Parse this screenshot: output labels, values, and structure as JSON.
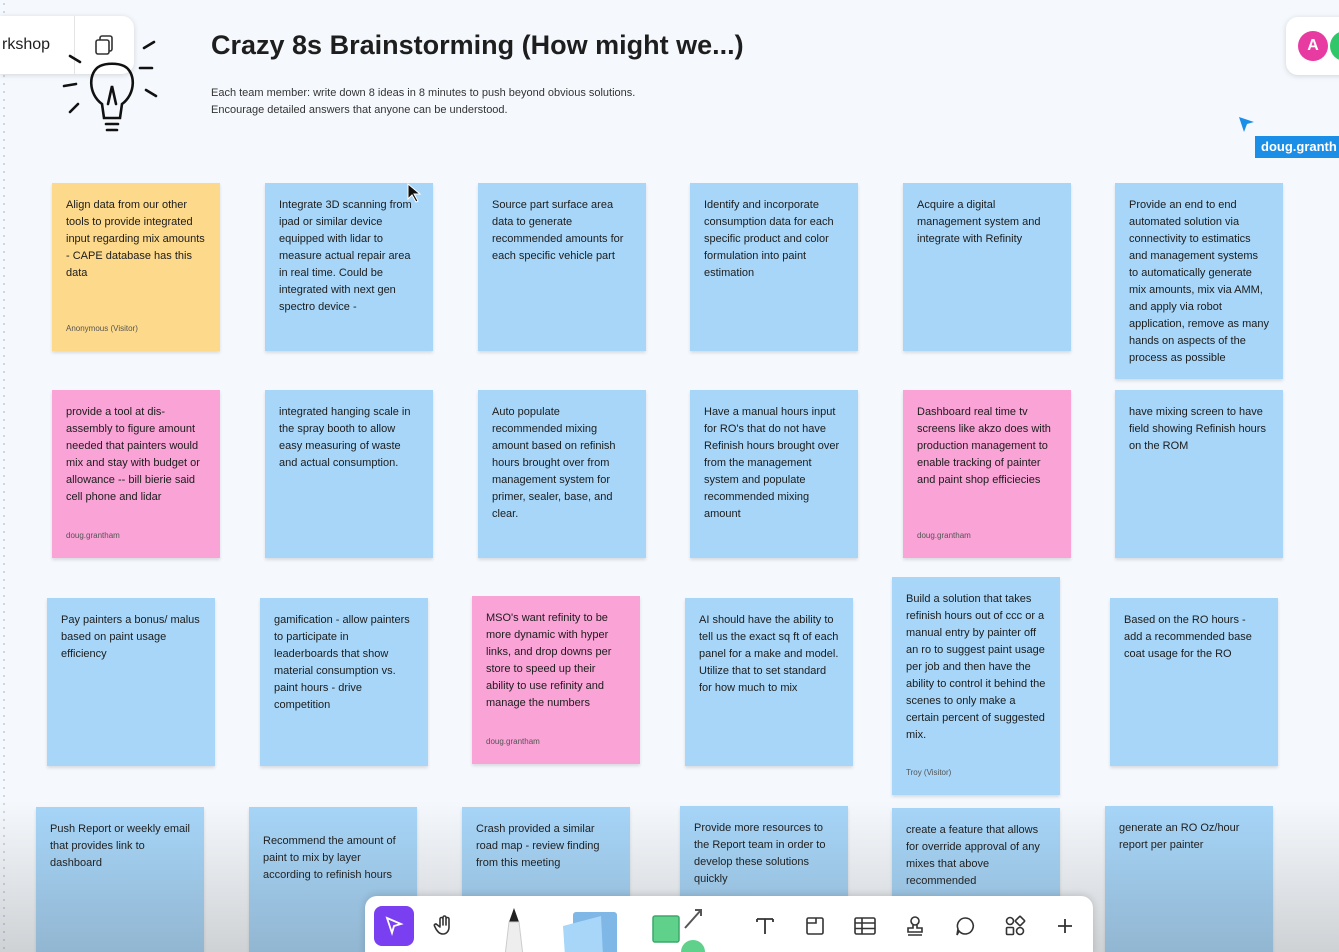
{
  "file": {
    "name": "rkshop"
  },
  "header": {
    "title": "Crazy 8s Brainstorming (How might we...)",
    "subtitle_line1": "Each team member: write down 8 ideas in 8 minutes to push beyond obvious solutions.",
    "subtitle_line2": "Encourage detailed answers that anyone can be understood."
  },
  "collaborators": {
    "avatar_a": "A",
    "cursor_label": "doug.granth"
  },
  "colors": {
    "blue": "#a7d6f9",
    "yellow": "#fdd98b",
    "pink": "#f9a3d6",
    "accent": "#7b3ff2",
    "cursor": "#1b8ee8"
  },
  "notes": [
    {
      "color": "yellow",
      "text": "Align data from our other tools to provide integrated input regarding mix amounts - CAPE database has this data",
      "author": "Anonymous (Visitor)"
    },
    {
      "color": "blue",
      "text": "Integrate 3D scanning from ipad or similar device equipped with lidar to measure actual repair area in real time.  Could be integrated with next gen spectro device -",
      "author": ""
    },
    {
      "color": "blue",
      "text": "Source part surface area data to generate recommended amounts for each specific vehicle part",
      "author": ""
    },
    {
      "color": "blue",
      "text": "Identify and incorporate consumption data for each specific product and color formulation into paint estimation",
      "author": ""
    },
    {
      "color": "blue",
      "text": "Acquire a digital management system and integrate with Refinity",
      "author": ""
    },
    {
      "color": "blue",
      "text": "Provide an end to end automated solution via connectivity to estimatics and management systems to automatically generate mix amounts, mix via AMM, and apply via robot application, remove as many hands on aspects of the process as possible",
      "author": ""
    },
    {
      "color": "pink",
      "text": "provide a tool at dis-assembly to figure amount needed that painters would mix and stay with budget or allowance -- bill bierie said cell phone and lidar",
      "author": "doug.grantham"
    },
    {
      "color": "blue",
      "text": "integrated hanging scale in the spray booth to allow easy measuring of waste and actual consumption.",
      "author": ""
    },
    {
      "color": "blue",
      "text": "Auto populate recommended mixing amount based on refinish hours brought over from management system for primer, sealer, base, and clear.",
      "author": ""
    },
    {
      "color": "blue",
      "text": "Have a manual hours input for RO's that do not have Refinish hours brought over from the management system and populate recommended mixing amount",
      "author": ""
    },
    {
      "color": "pink",
      "text": "Dashboard real time tv screens like akzo does with production management to enable tracking of painter and paint shop efficiecies",
      "author": "doug.grantham"
    },
    {
      "color": "blue",
      "text": "have mixing screen to have field showing Refinish hours on the ROM",
      "author": ""
    },
    {
      "color": "blue",
      "text": "Pay painters a bonus/ malus based on paint usage efficiency",
      "author": ""
    },
    {
      "color": "blue",
      "text": "gamification - allow painters to participate in leaderboards that show material consumption vs. paint hours - drive competition",
      "author": ""
    },
    {
      "color": "pink",
      "text": "MSO's want refinity to be more dynamic with hyper links, and drop downs per store to speed up their ability to use refinity and manage the numbers",
      "author": "doug.grantham"
    },
    {
      "color": "blue",
      "text": "AI should have the ability to tell us the exact sq ft of each panel for a make and model. Utilize that to set standard for how much to mix",
      "author": ""
    },
    {
      "color": "blue",
      "text": "Build a solution that takes refinish hours out of ccc or a manual entry by painter off an ro to suggest paint usage per job and then have the ability to control it behind the scenes to only make a certain percent of suggested mix.",
      "author": "Troy (Visitor)"
    },
    {
      "color": "blue",
      "text": "Based on the RO hours - add a recommended base coat usage for the RO",
      "author": ""
    },
    {
      "color": "blue",
      "text": "Push Report or weekly email that provides link to dashboard",
      "author": ""
    },
    {
      "color": "blue",
      "text": "Recommend the amount of paint to mix by layer according to refinish hours",
      "author": ""
    },
    {
      "color": "blue",
      "text": "Crash provided a similar road map - review finding from this meeting",
      "author": ""
    },
    {
      "color": "blue",
      "text": "Provide more resources to the Report team  in order to develop these solutions quickly",
      "author": ""
    },
    {
      "color": "blue",
      "text": "create a feature that allows for override approval of any mixes that above recommended",
      "author": ""
    },
    {
      "color": "blue",
      "text": "generate an RO Oz/hour report per painter",
      "author": ""
    }
  ],
  "toolbar": {
    "tools": [
      {
        "icon": "select-arrow-icon",
        "active": true
      },
      {
        "icon": "hand-icon",
        "active": false
      },
      {
        "icon": "marker-icon",
        "active": false
      },
      {
        "icon": "sticky-stack-icon",
        "active": false
      },
      {
        "icon": "shapes-icon",
        "active": false
      },
      {
        "icon": "text-icon",
        "active": false
      },
      {
        "icon": "section-icon",
        "active": false
      },
      {
        "icon": "table-icon",
        "active": false
      },
      {
        "icon": "stamp-icon",
        "active": false
      },
      {
        "icon": "comment-icon",
        "active": false
      },
      {
        "icon": "widgets-icon",
        "active": false
      },
      {
        "icon": "plus-icon",
        "active": false
      }
    ]
  }
}
